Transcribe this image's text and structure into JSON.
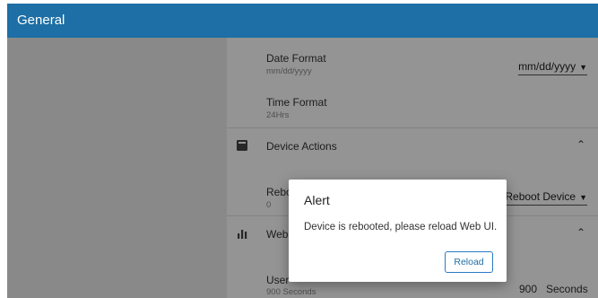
{
  "header": {
    "title": "General"
  },
  "date_format": {
    "label": "Date Format",
    "value_sub": "mm/dd/yyyy",
    "select_value": "mm/dd/yyyy"
  },
  "time_format": {
    "label": "Time Format",
    "value_sub": "24Hrs"
  },
  "device_actions": {
    "title": "Device Actions",
    "reboot": {
      "label": "Reboot",
      "sub": "0",
      "select_value": "Reboot Device"
    }
  },
  "web_section": {
    "title": "Web UI",
    "user_timeout": {
      "label": "User",
      "sub": "900 Seconds",
      "value": "900",
      "unit": "Seconds"
    }
  },
  "dialog": {
    "title": "Alert",
    "message": "Device is rebooted, please reload Web UI.",
    "button_label": "Reload"
  },
  "icons": {
    "device_actions": "device-card-icon",
    "web": "bar-chart-icon",
    "collapse": "chevron-up-icon",
    "dropdown": "caret-down-icon"
  },
  "colors": {
    "header": "#1d6fa5",
    "accent": "#2a7bc4",
    "overlay": "rgba(0,0,0,0.42)"
  }
}
